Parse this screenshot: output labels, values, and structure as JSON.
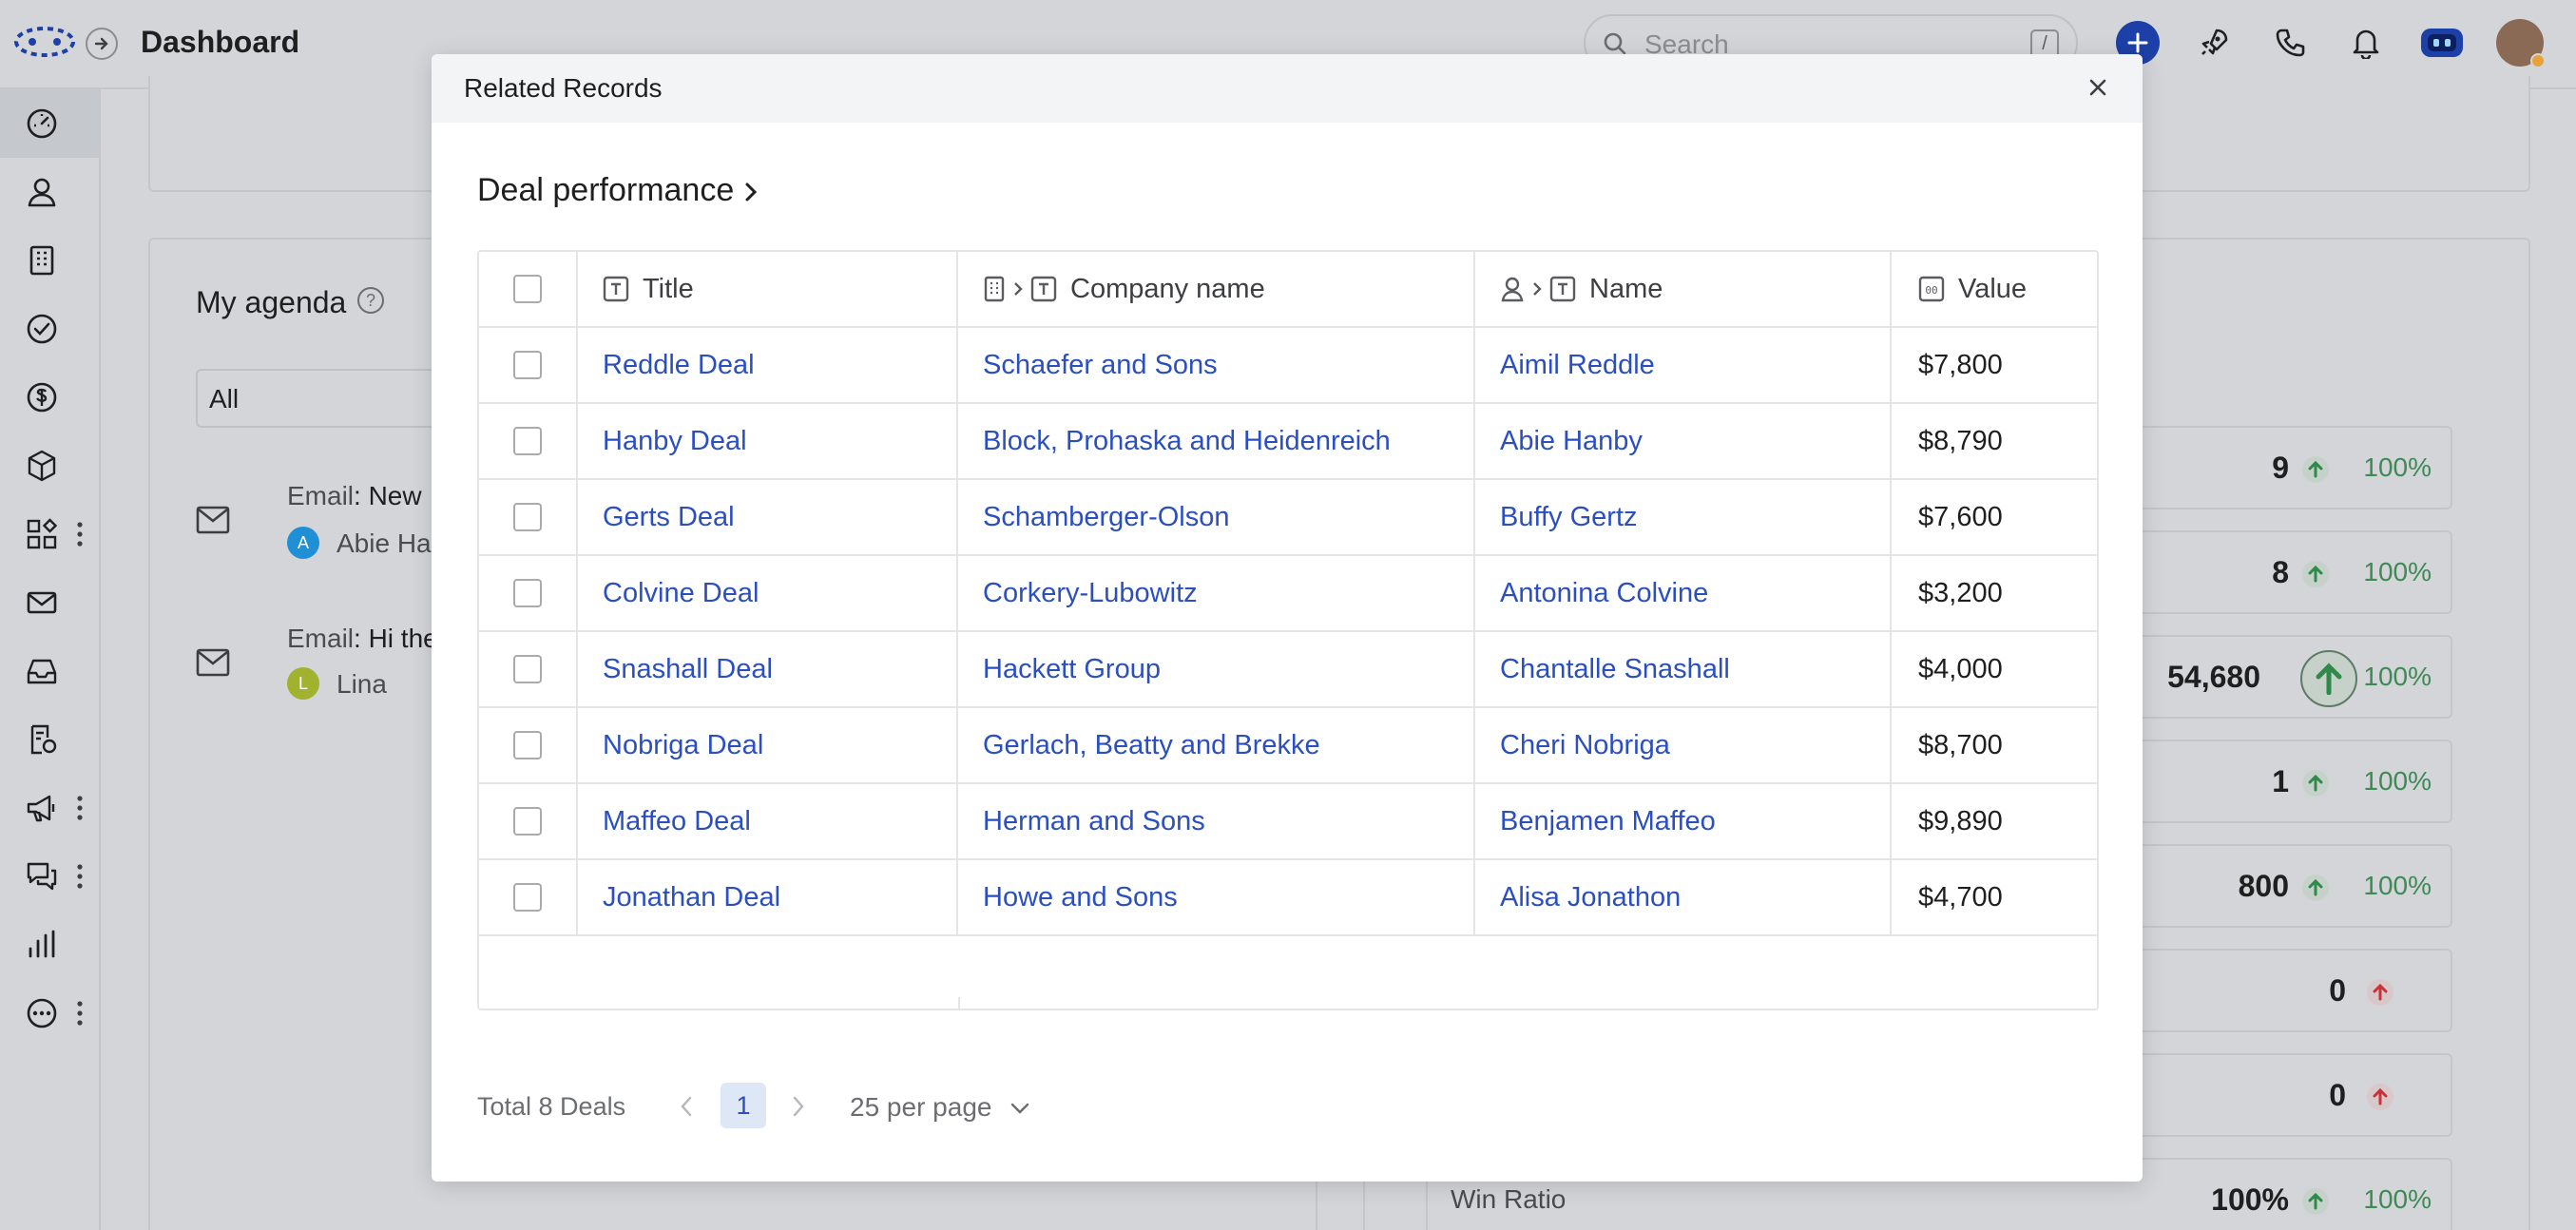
{
  "header": {
    "title": "Dashboard",
    "search_placeholder": "Search",
    "search_shortcut": "/"
  },
  "sidebar": {
    "items": [
      {
        "icon": "gauge-icon",
        "active": true
      },
      {
        "icon": "user-icon"
      },
      {
        "icon": "building-icon"
      },
      {
        "icon": "check-circle-icon"
      },
      {
        "icon": "dollar-icon"
      },
      {
        "icon": "box-icon"
      },
      {
        "icon": "apps-icon",
        "more": true
      },
      {
        "icon": "mail-icon"
      },
      {
        "icon": "inbox-icon"
      },
      {
        "icon": "contract-icon"
      },
      {
        "icon": "megaphone-icon",
        "more": true
      },
      {
        "icon": "chat-icon",
        "more": true
      },
      {
        "icon": "bar-chart-icon"
      },
      {
        "icon": "more-circle-icon",
        "more": true
      }
    ]
  },
  "agenda": {
    "title": "My agenda",
    "filter_value": "All",
    "items": [
      {
        "type_label": "Email",
        "text": ": New",
        "avatar_letter": "A",
        "avatar_color": "#1f8fd6",
        "person": "Abie Ha"
      },
      {
        "type_label": "Email",
        "text": ": Hi the",
        "avatar_letter": "L",
        "avatar_color": "#a0b22e",
        "person": "Lina"
      }
    ]
  },
  "stats": [
    {
      "value": "9",
      "pct": "100%",
      "direction": "up"
    },
    {
      "value": "8",
      "pct": "100%",
      "direction": "up"
    },
    {
      "value": "54,680",
      "pct": "100%",
      "direction": "up",
      "highlight": true
    },
    {
      "value": "1",
      "pct": "100%",
      "direction": "up"
    },
    {
      "value": "800",
      "pct": "100%",
      "direction": "up"
    },
    {
      "value": "0",
      "pct": "",
      "direction": "up-red"
    },
    {
      "value": "0",
      "pct": "",
      "direction": "up-red"
    },
    {
      "label": "Win Ratio",
      "value": "100%",
      "pct": "100%",
      "direction": "up"
    }
  ],
  "modal": {
    "title": "Related Records",
    "section_title": "Deal performance",
    "columns": {
      "title": "Title",
      "company": "Company name",
      "name": "Name",
      "value": "Value"
    },
    "rows": [
      {
        "title": "Reddle Deal",
        "company": "Schaefer and Sons",
        "name": "Aimil Reddle",
        "value": "$7,800"
      },
      {
        "title": "Hanby Deal",
        "company": "Block, Prohaska and Heidenreich",
        "name": "Abie Hanby",
        "value": "$8,790"
      },
      {
        "title": "Gerts Deal",
        "company": "Schamberger-Olson",
        "name": "Buffy Gertz",
        "value": "$7,600"
      },
      {
        "title": "Colvine Deal",
        "company": "Corkery-Lubowitz",
        "name": "Antonina Colvine",
        "value": "$3,200"
      },
      {
        "title": "Snashall Deal",
        "company": "Hackett Group",
        "name": "Chantalle Snashall",
        "value": "$4,000"
      },
      {
        "title": "Nobriga Deal",
        "company": "Gerlach, Beatty and Brekke",
        "name": "Cheri Nobriga",
        "value": "$8,700"
      },
      {
        "title": "Maffeo Deal",
        "company": "Herman and Sons",
        "name": "Benjamen Maffeo",
        "value": "$9,890"
      },
      {
        "title": "Jonathan Deal",
        "company": "Howe and Sons",
        "name": "Alisa Jonathon",
        "value": "$4,700"
      }
    ],
    "pagination": {
      "total": "Total 8 Deals",
      "current_page": "1",
      "per_page": "25 per page"
    }
  },
  "colors": {
    "link": "#2b4fbf",
    "accent": "#1d40a8",
    "positive": "#3e8a55",
    "negative": "#c8323a"
  }
}
